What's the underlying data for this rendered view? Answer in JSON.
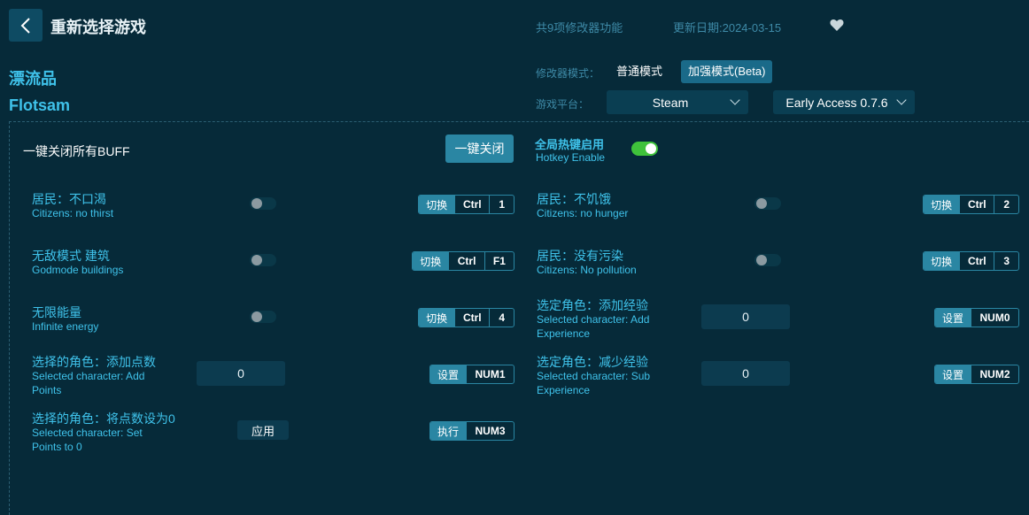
{
  "header": {
    "title": "重新选择游戏",
    "features_count": "共9项修改器功能",
    "update_date": "更新日期:2024-03-15",
    "favorite_icon": "heart-icon"
  },
  "game": {
    "name_cn": "漂流品",
    "name_en": "Flotsam"
  },
  "mode": {
    "label": "修改器模式：",
    "normal": "普通模式",
    "enhanced": "加强模式(Beta)",
    "active": "enhanced"
  },
  "platform": {
    "label": "游戏平台：",
    "selected": "Steam",
    "version": "Early Access 0.7.6"
  },
  "toolbar": {
    "all_buff_label": "一键关闭所有BUFF",
    "all_off_button": "一键关闭",
    "hotkey_cn": "全局热键启用",
    "hotkey_en": "Hotkey Enable",
    "hotkey_enabled": true
  },
  "options": [
    {
      "cn": "居民：不口渴",
      "en": "Citizens: no thirst",
      "action": "切换",
      "keys": [
        "Ctrl",
        "1"
      ]
    },
    {
      "cn": "居民：不饥饿",
      "en": "Citizens: no hunger",
      "action": "切换",
      "keys": [
        "Ctrl",
        "2"
      ]
    },
    {
      "cn": "无敌模式 建筑",
      "en": "Godmode buildings",
      "action": "切换",
      "keys": [
        "Ctrl",
        "F1"
      ]
    },
    {
      "cn": "居民：没有污染",
      "en": "Citizens: No pollution",
      "action": "切换",
      "keys": [
        "Ctrl",
        "3"
      ]
    },
    {
      "cn": "无限能量",
      "en": "Infinite energy",
      "action": "切换",
      "keys": [
        "Ctrl",
        "4"
      ]
    },
    {
      "cn": "选定角色：添加经验",
      "en1": "Selected character: Add",
      "en2": "Experience",
      "value": "0",
      "action": "设置",
      "keys": [
        "NUM0"
      ]
    },
    {
      "cn": "选择的角色：添加点数",
      "en1": "Selected character: Add",
      "en2": "Points",
      "value": "0",
      "action": "设置",
      "keys": [
        "NUM1"
      ]
    },
    {
      "cn": "选定角色：减少经验",
      "en1": "Selected character: Sub",
      "en2": "Experience",
      "value": "0",
      "action": "设置",
      "keys": [
        "NUM2"
      ]
    },
    {
      "cn": "选择的角色：将点数设为0",
      "en1": "Selected character: Set",
      "en2": "Points to 0",
      "apply": "应用",
      "action": "执行",
      "keys": [
        "NUM3"
      ]
    }
  ]
}
